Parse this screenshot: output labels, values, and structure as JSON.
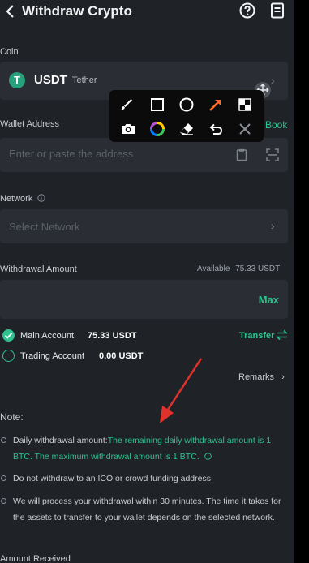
{
  "header": {
    "title": "Withdraw Crypto"
  },
  "coin": {
    "label": "Coin",
    "code": "USDT",
    "name": "Tether",
    "logo_glyph": "T",
    "logo_color": "#26a17b"
  },
  "wallet": {
    "label": "Wallet Address",
    "address_book": "Book",
    "placeholder": "Enter or paste the address",
    "value": ""
  },
  "network": {
    "label": "Network",
    "placeholder": "Select Network"
  },
  "amount": {
    "label": "Withdrawal Amount",
    "available_label": "Available",
    "available_value": "75.33 USDT",
    "max_label": "Max",
    "value": ""
  },
  "accounts": [
    {
      "name": "Main Account",
      "value": "75.33 USDT",
      "selected": true
    },
    {
      "name": "Trading Account",
      "value": "0.00 USDT",
      "selected": false
    }
  ],
  "transfer_label": "Transfer",
  "remarks_label": "Remarks",
  "notes": {
    "title": "Note:",
    "item1_prefix": "Daily withdrawal amount:",
    "item1_green": "The remaining daily withdrawal amount is 1 BTC. The maximum withdrawal amount is 1 BTC.",
    "item2": "Do not withdraw to an ICO or crowd funding address.",
    "item3": "We will process your withdrawal within 30 minutes. The time it takes for the assets to transfer to your wallet depends on the selected network."
  },
  "amount_received_label": "Amount Received",
  "colors": {
    "accent": "#2ec28f",
    "background": "#1f2227",
    "field": "#2a2d33",
    "annotation_arrow": "#e0322b",
    "toolbar": "#0b0b0c"
  },
  "annotation_toolbar": {
    "row1": [
      "brush-tool-icon",
      "rectangle-tool-icon",
      "circle-tool-icon",
      "arrow-tool-icon",
      "mosaic-tool-icon"
    ],
    "row2": [
      "camera-tool-icon",
      "color-picker-icon",
      "eraser-tool-icon",
      "undo-icon",
      "close-icon"
    ]
  }
}
